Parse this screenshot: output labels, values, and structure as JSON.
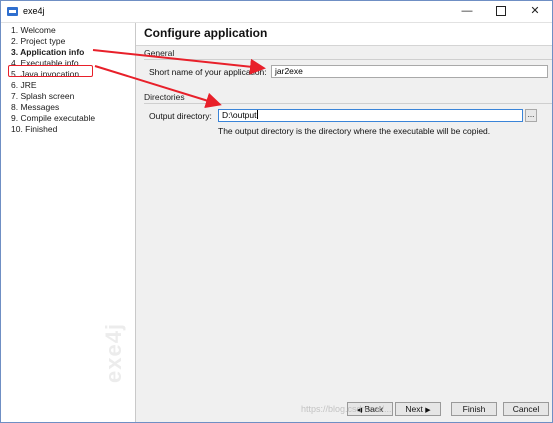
{
  "window": {
    "title": "exe4j",
    "minimize_glyph": "—",
    "close_glyph": "✕"
  },
  "sidebar": {
    "steps": [
      {
        "label": "1. Welcome",
        "active": false
      },
      {
        "label": "2. Project type",
        "active": false
      },
      {
        "label": "3. Application info",
        "active": true
      },
      {
        "label": "4. Executable info",
        "active": false
      },
      {
        "label": "5. Java invocation",
        "active": false
      },
      {
        "label": "6. JRE",
        "active": false
      },
      {
        "label": "7. Splash screen",
        "active": false
      },
      {
        "label": "8. Messages",
        "active": false
      },
      {
        "label": "9. Compile executable",
        "active": false
      },
      {
        "label": "10. Finished",
        "active": false
      }
    ],
    "logo_text": "exe4j"
  },
  "main": {
    "title": "Configure application",
    "general": {
      "label": "General",
      "short_name_label": "Short name of your application:",
      "short_name_value": "jar2exe"
    },
    "directories": {
      "label": "Directories",
      "output_label": "Output directory:",
      "output_value": "D:\\output",
      "browse_label": "...",
      "hint": "The output directory is the directory where the executable will be copied."
    }
  },
  "footer": {
    "back_arrow": "◀",
    "back_label": "Back",
    "next_label": "Next",
    "next_arrow": "▶",
    "finish_label": "Finish",
    "cancel_label": "Cancel"
  },
  "watermark": "https://blog.csdn.net/..."
}
